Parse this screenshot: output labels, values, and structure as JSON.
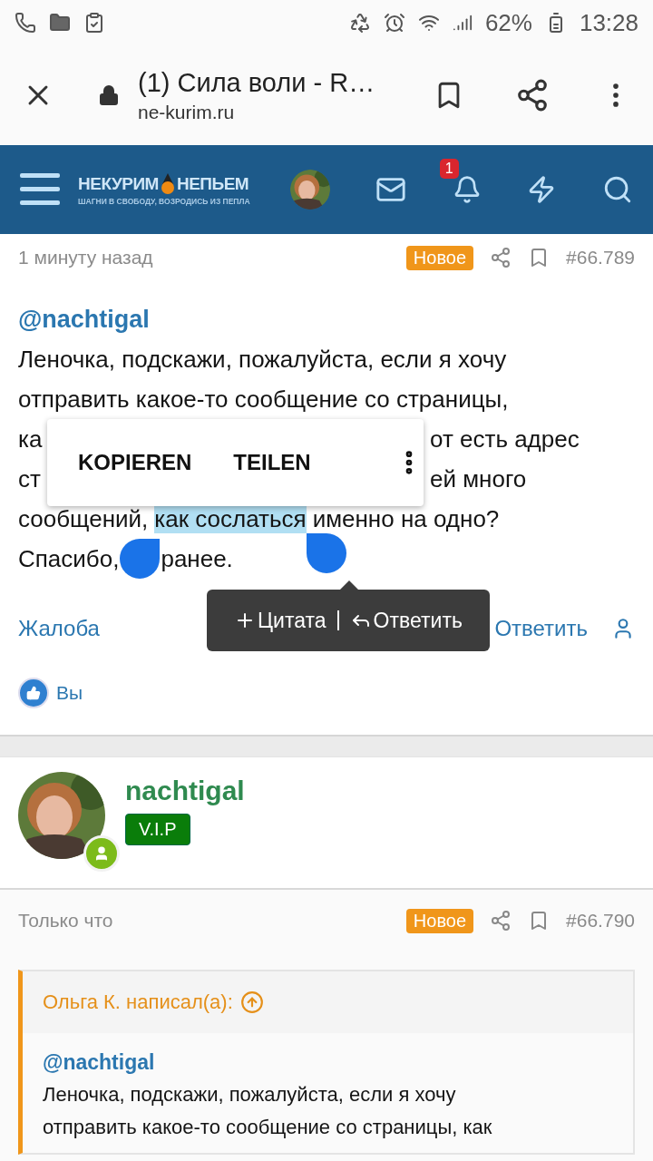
{
  "status_bar": {
    "battery": "62%",
    "time": "13:28"
  },
  "browser_bar": {
    "title": "(1) Сила воли - R…",
    "url": "ne-kurim.ru"
  },
  "site_header": {
    "logo_left": "НЕКУРИМ",
    "logo_right": "НЕПЬЕМ",
    "tagline": "ШАГНИ В СВОБОДУ, ВОЗРОДИСЬ ИЗ ПЕПЛА",
    "notification_count": "1"
  },
  "post": {
    "time": "1 минуту назад",
    "badge": "Новое",
    "number": "#66.789",
    "mention": "@nachtigal",
    "lines": [
      [
        {
          "kind": "text",
          "text": "Леночка, подскажи, пожалуйста, если я хочу"
        }
      ],
      [
        {
          "kind": "text",
          "text": "отправить какое-то сообщение со страницы,"
        }
      ],
      [
        {
          "kind": "text",
          "text": "ка"
        },
        {
          "kind": "covered"
        },
        {
          "kind": "text",
          "text": "от есть адрес"
        }
      ],
      [
        {
          "kind": "text",
          "text": "ст"
        },
        {
          "kind": "covered"
        },
        {
          "kind": "text",
          "text": "ей много"
        }
      ],
      [
        {
          "kind": "text",
          "text": "сообщений,"
        },
        {
          "kind": "selected",
          "text": "как сослаться"
        },
        {
          "kind": "text",
          "text": "именно на одно?"
        }
      ],
      [
        {
          "kind": "text",
          "text": "Спасибо,"
        },
        {
          "kind": "handle"
        },
        {
          "kind": "text",
          "text": "ранее."
        }
      ]
    ],
    "report": "Жалоба",
    "reply": "Ответить",
    "reaction": "Вы"
  },
  "selection_menu": {
    "items": [
      {
        "label": "KOPIEREN"
      },
      {
        "label": "TEILEN"
      }
    ]
  },
  "quote_toolbar": {
    "items": [
      {
        "kind": "quote",
        "label": "Цитата"
      },
      {
        "kind": "reply",
        "label": "Ответить"
      }
    ]
  },
  "author": {
    "name": "nachtigal",
    "rank": "V.I.P"
  },
  "next_post": {
    "time": "Только что",
    "badge": "Новое",
    "number": "#66.790",
    "quote": {
      "header": "Ольга К. написал(а):",
      "mention": "@nachtigal",
      "lines": [
        "Леночка, подскажи, пожалуйста, если я хочу",
        "отправить какое-то сообщение со страницы, как"
      ]
    }
  }
}
